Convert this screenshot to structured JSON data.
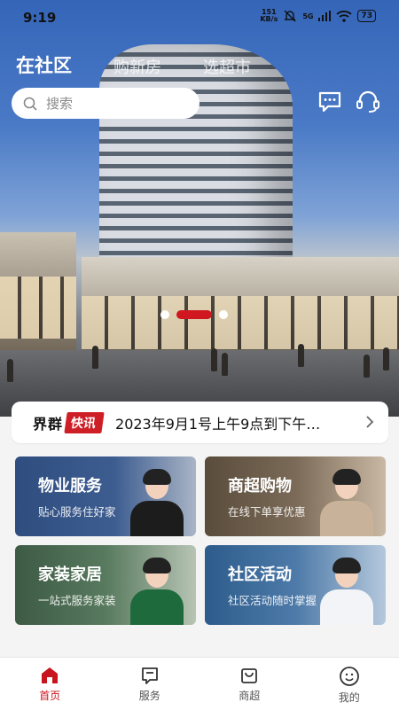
{
  "status_bar": {
    "time": "9:19",
    "net_speed_value": "151",
    "net_speed_unit": "KB/s",
    "signal": "5G",
    "battery": "73"
  },
  "header": {
    "tabs": [
      {
        "label": "在社区",
        "active": true
      },
      {
        "label": "购新房",
        "active": false
      },
      {
        "label": "选超市",
        "active": false
      }
    ],
    "search_placeholder": "搜索",
    "icons": [
      "message-icon",
      "customer-service-icon"
    ]
  },
  "banner": {
    "slides": 3,
    "active_index": 1
  },
  "news": {
    "brand": "界群",
    "tag": "快讯",
    "text": "2023年9月1号上午9点到下午…"
  },
  "services": [
    {
      "title": "物业服务",
      "subtitle": "贴心服务住好家"
    },
    {
      "title": "商超购物",
      "subtitle": "在线下单享优惠"
    },
    {
      "title": "家装家居",
      "subtitle": "一站式服务家装"
    },
    {
      "title": "社区活动",
      "subtitle": "社区活动随时掌握"
    }
  ],
  "bottom_nav": [
    {
      "label": "首页",
      "icon": "home-icon",
      "active": true
    },
    {
      "label": "服务",
      "icon": "service-icon",
      "active": false
    },
    {
      "label": "商超",
      "icon": "shopping-bag-icon",
      "active": false
    },
    {
      "label": "我的",
      "icon": "profile-icon",
      "active": false
    }
  ],
  "colors": {
    "accent": "#c8141c",
    "page_bg": "#f4f4f4"
  }
}
